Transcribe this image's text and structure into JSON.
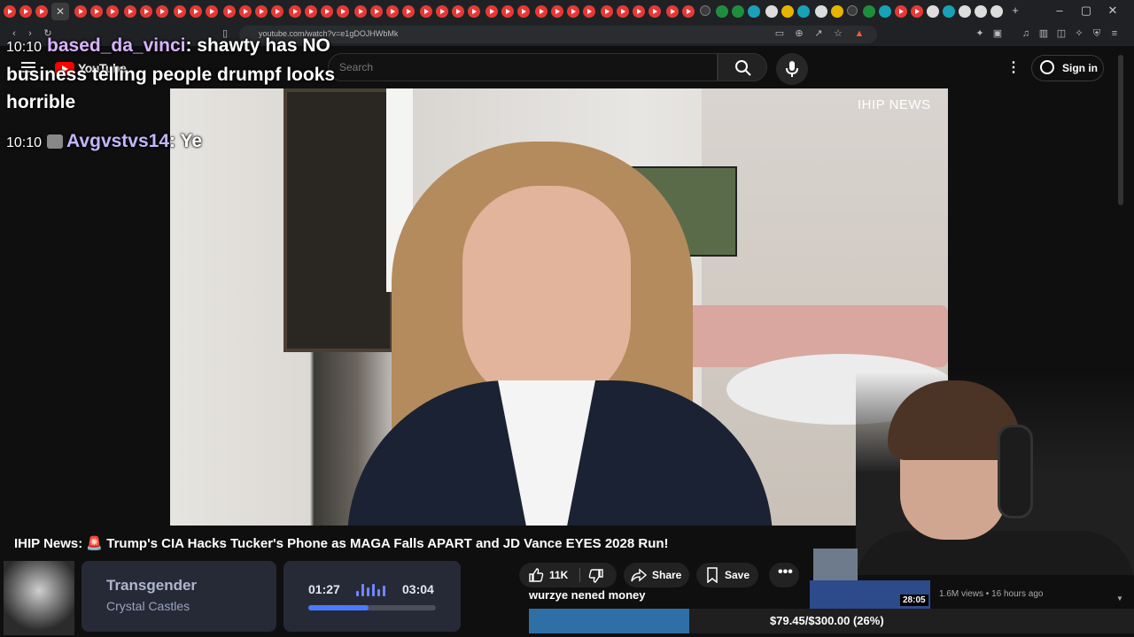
{
  "browser": {
    "url": "youtube.com/watch?v=e1gDOJHWbMk",
    "window_controls": {
      "minimize": "–",
      "maximize": "▢",
      "close": "✕"
    },
    "new_tab": "+",
    "active_tab_close": "✕"
  },
  "youtube": {
    "logo_text": "YouTube",
    "search_placeholder": "Search",
    "signin_label": "Sign in"
  },
  "video": {
    "channel_brand": "IHIP NEWS",
    "title": "IHIP News: 🚨 Trump's CIA Hacks Tucker's Phone as MAGA Falls APART and JD Vance EYES 2028 Run!",
    "likes": "11K",
    "share_label": "Share",
    "save_label": "Save"
  },
  "chat": [
    {
      "time": "10:10",
      "user": "based_da_vinci",
      "message_line1": "shawty has NO",
      "message_line2": "business telling people drumpf looks",
      "message_line3": "horrible"
    },
    {
      "time": "10:10",
      "user": "Avgvstvs14",
      "message_line1": "Ye"
    }
  ],
  "music": {
    "track": "Transgender",
    "artist": "Crystal Castles",
    "elapsed": "01:27",
    "total": "03:04",
    "progress_fraction": 0.47
  },
  "overlay_text": "wurzye nened money",
  "goal": {
    "text": "$79.45/$300.00 (26%)",
    "fraction": 0.265
  },
  "recommendation": {
    "duration": "28:05",
    "meta": "1.6M views • 16 hours ago"
  },
  "colors": {
    "chat_name": "#d8b4fe",
    "goal_fill": "#2e6fa6",
    "progress": "#4a7bff",
    "yt_red": "#ff0000"
  }
}
